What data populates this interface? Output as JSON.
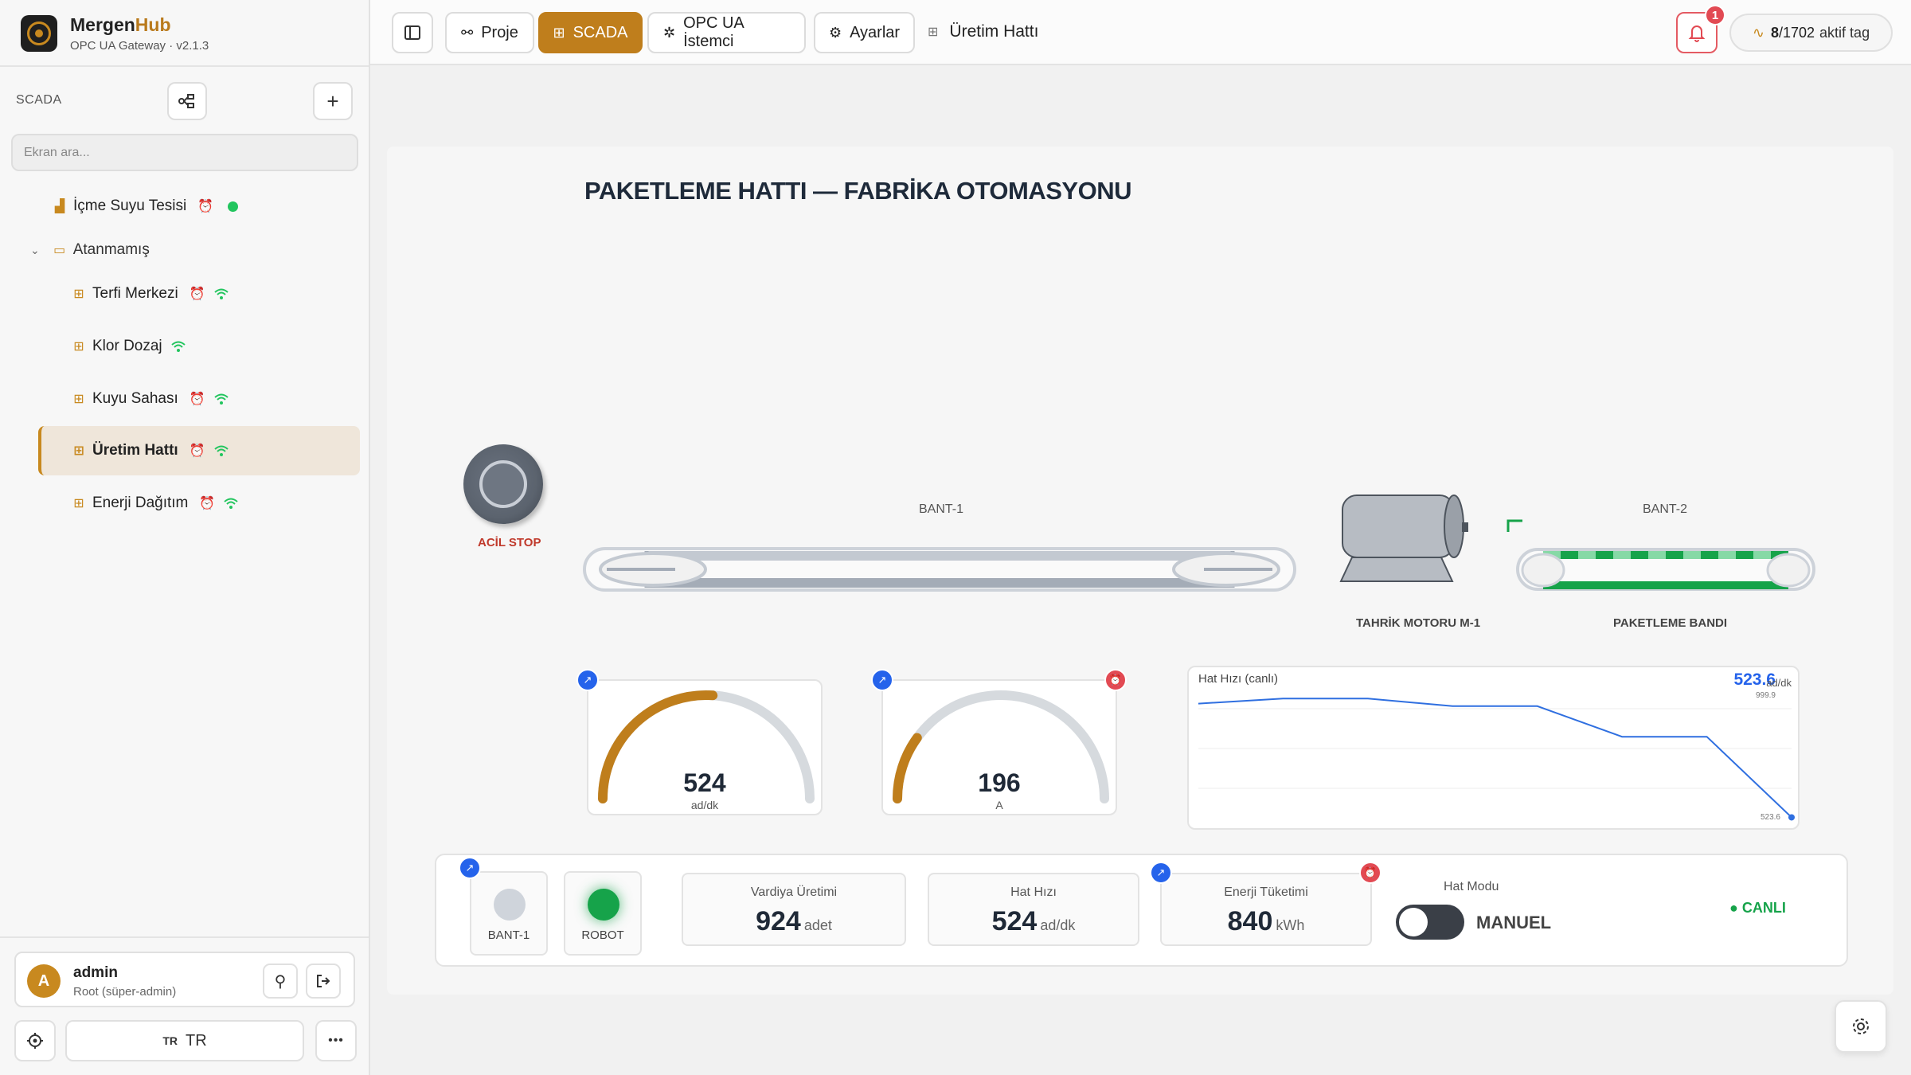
{
  "brand": {
    "name_main": "Mergen",
    "name_accent": "Hub",
    "subtitle": "OPC UA Gateway · v2.1.3"
  },
  "sidebar": {
    "section_label": "SCADA",
    "search_placeholder": "Ekran ara...",
    "items": [
      {
        "label": "İçme Suyu Tesisi",
        "level": 0,
        "alarm": true,
        "online": true
      },
      {
        "label": "Atanmamış",
        "level": 0,
        "group": true
      },
      {
        "label": "Terfi Merkezi",
        "level": 1,
        "alarm": true,
        "wifi": true
      },
      {
        "label": "Klor Dozaj",
        "level": 1,
        "alarm": false,
        "wifi": true
      },
      {
        "label": "Kuyu Sahası",
        "level": 1,
        "alarm": true,
        "wifi": true
      },
      {
        "label": "Üretim Hattı",
        "level": 1,
        "alarm": true,
        "wifi": true,
        "active": true
      },
      {
        "label": "Enerji Dağıtım",
        "level": 1,
        "alarm": true,
        "wifi": true
      }
    ],
    "user": {
      "initial": "A",
      "name": "admin",
      "role": "Root (süper-admin)"
    },
    "language": {
      "code": "TR",
      "label": "TR"
    }
  },
  "topbar": {
    "buttons": [
      {
        "label": "Proje",
        "icon": "share-nodes-icon"
      },
      {
        "label": "SCADA",
        "icon": "grid-icon",
        "active": true
      },
      {
        "label": "OPC UA İstemci",
        "icon": "plug-icon"
      },
      {
        "label": "Ayarlar",
        "icon": "gear-icon"
      }
    ],
    "breadcrumb": "Üretim Hattı",
    "notifications": "1",
    "tags_active": "8",
    "tags_total": "/1702",
    "tags_suffix": "aktif tag"
  },
  "scada": {
    "title": "PAKETLEME HATTI — FABRİKA OTOMASYONU",
    "estop_label": "ACİL STOP",
    "belt1_label": "BANT-1",
    "belt2_label": "BANT-2",
    "motor_label": "TAHRİK MOTORU M-1",
    "packing_label": "PAKETLEME BANDI",
    "gauge1": {
      "value": "524",
      "unit": "ad/dk",
      "fraction": 0.52
    },
    "gauge2": {
      "value": "196",
      "unit": "A",
      "fraction": 0.2
    },
    "chart": {
      "title": "Hat Hızı (canlı)",
      "current": "523.6",
      "unit": "ad/dk",
      "max_label": "999.9",
      "min_label": "523.6"
    },
    "status": {
      "lamp1": "BANT-1",
      "lamp2": "ROBOT",
      "kpi1": {
        "title": "Vardiya Üretimi",
        "value": "924",
        "unit": "adet"
      },
      "kpi2": {
        "title": "Hat Hızı",
        "value": "524",
        "unit": "ad/dk"
      },
      "kpi3": {
        "title": "Enerji Tüketimi",
        "value": "840",
        "unit": "kWh"
      },
      "mode_title": "Hat Modu",
      "mode_value": "MANUEL",
      "live": "● CANLI"
    }
  },
  "chart_data": {
    "type": "line",
    "title": "Hat Hızı (canlı)",
    "x": [
      0,
      1,
      2,
      3,
      4,
      5,
      6,
      7
    ],
    "values": [
      970,
      990,
      990,
      960,
      960,
      840,
      840,
      523.6
    ],
    "ylim": [
      500,
      1050
    ],
    "grid": true
  },
  "colors": {
    "accent": "#bf7e1c",
    "alarm": "#e24a53",
    "live": "#16a34a",
    "chart": "#2563eb"
  }
}
